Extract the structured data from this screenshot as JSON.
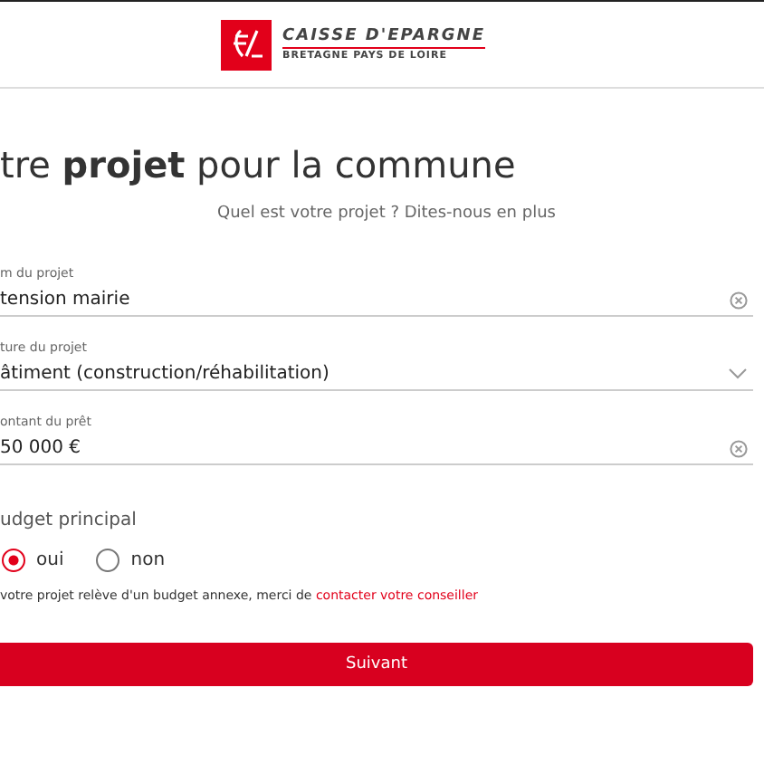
{
  "header": {
    "brand": "CAISSE D'EPARGNE",
    "region": "BRETAGNE PAYS DE LOIRE"
  },
  "title": "tre **projet** pour la commune",
  "subtitle": "Quel est votre projet ? Dites-nous en plus",
  "fields": [
    {
      "kind": "text",
      "label": "m du projet",
      "value": "tension mairie"
    },
    {
      "kind": "select",
      "label": "ture du projet",
      "value": "âtiment (construction/réhabilitation)"
    },
    {
      "kind": "text",
      "label": "ontant du prêt",
      "value": "50 000 €"
    }
  ],
  "budget": {
    "label": "udget principal",
    "options": [
      {
        "label": "oui",
        "selected": true
      },
      {
        "label": "non",
        "selected": false
      }
    ],
    "note": "votre projet relève d'un budget annexe, merci de ",
    "link": "contacter votre conseiller"
  },
  "button": "Suivant"
}
